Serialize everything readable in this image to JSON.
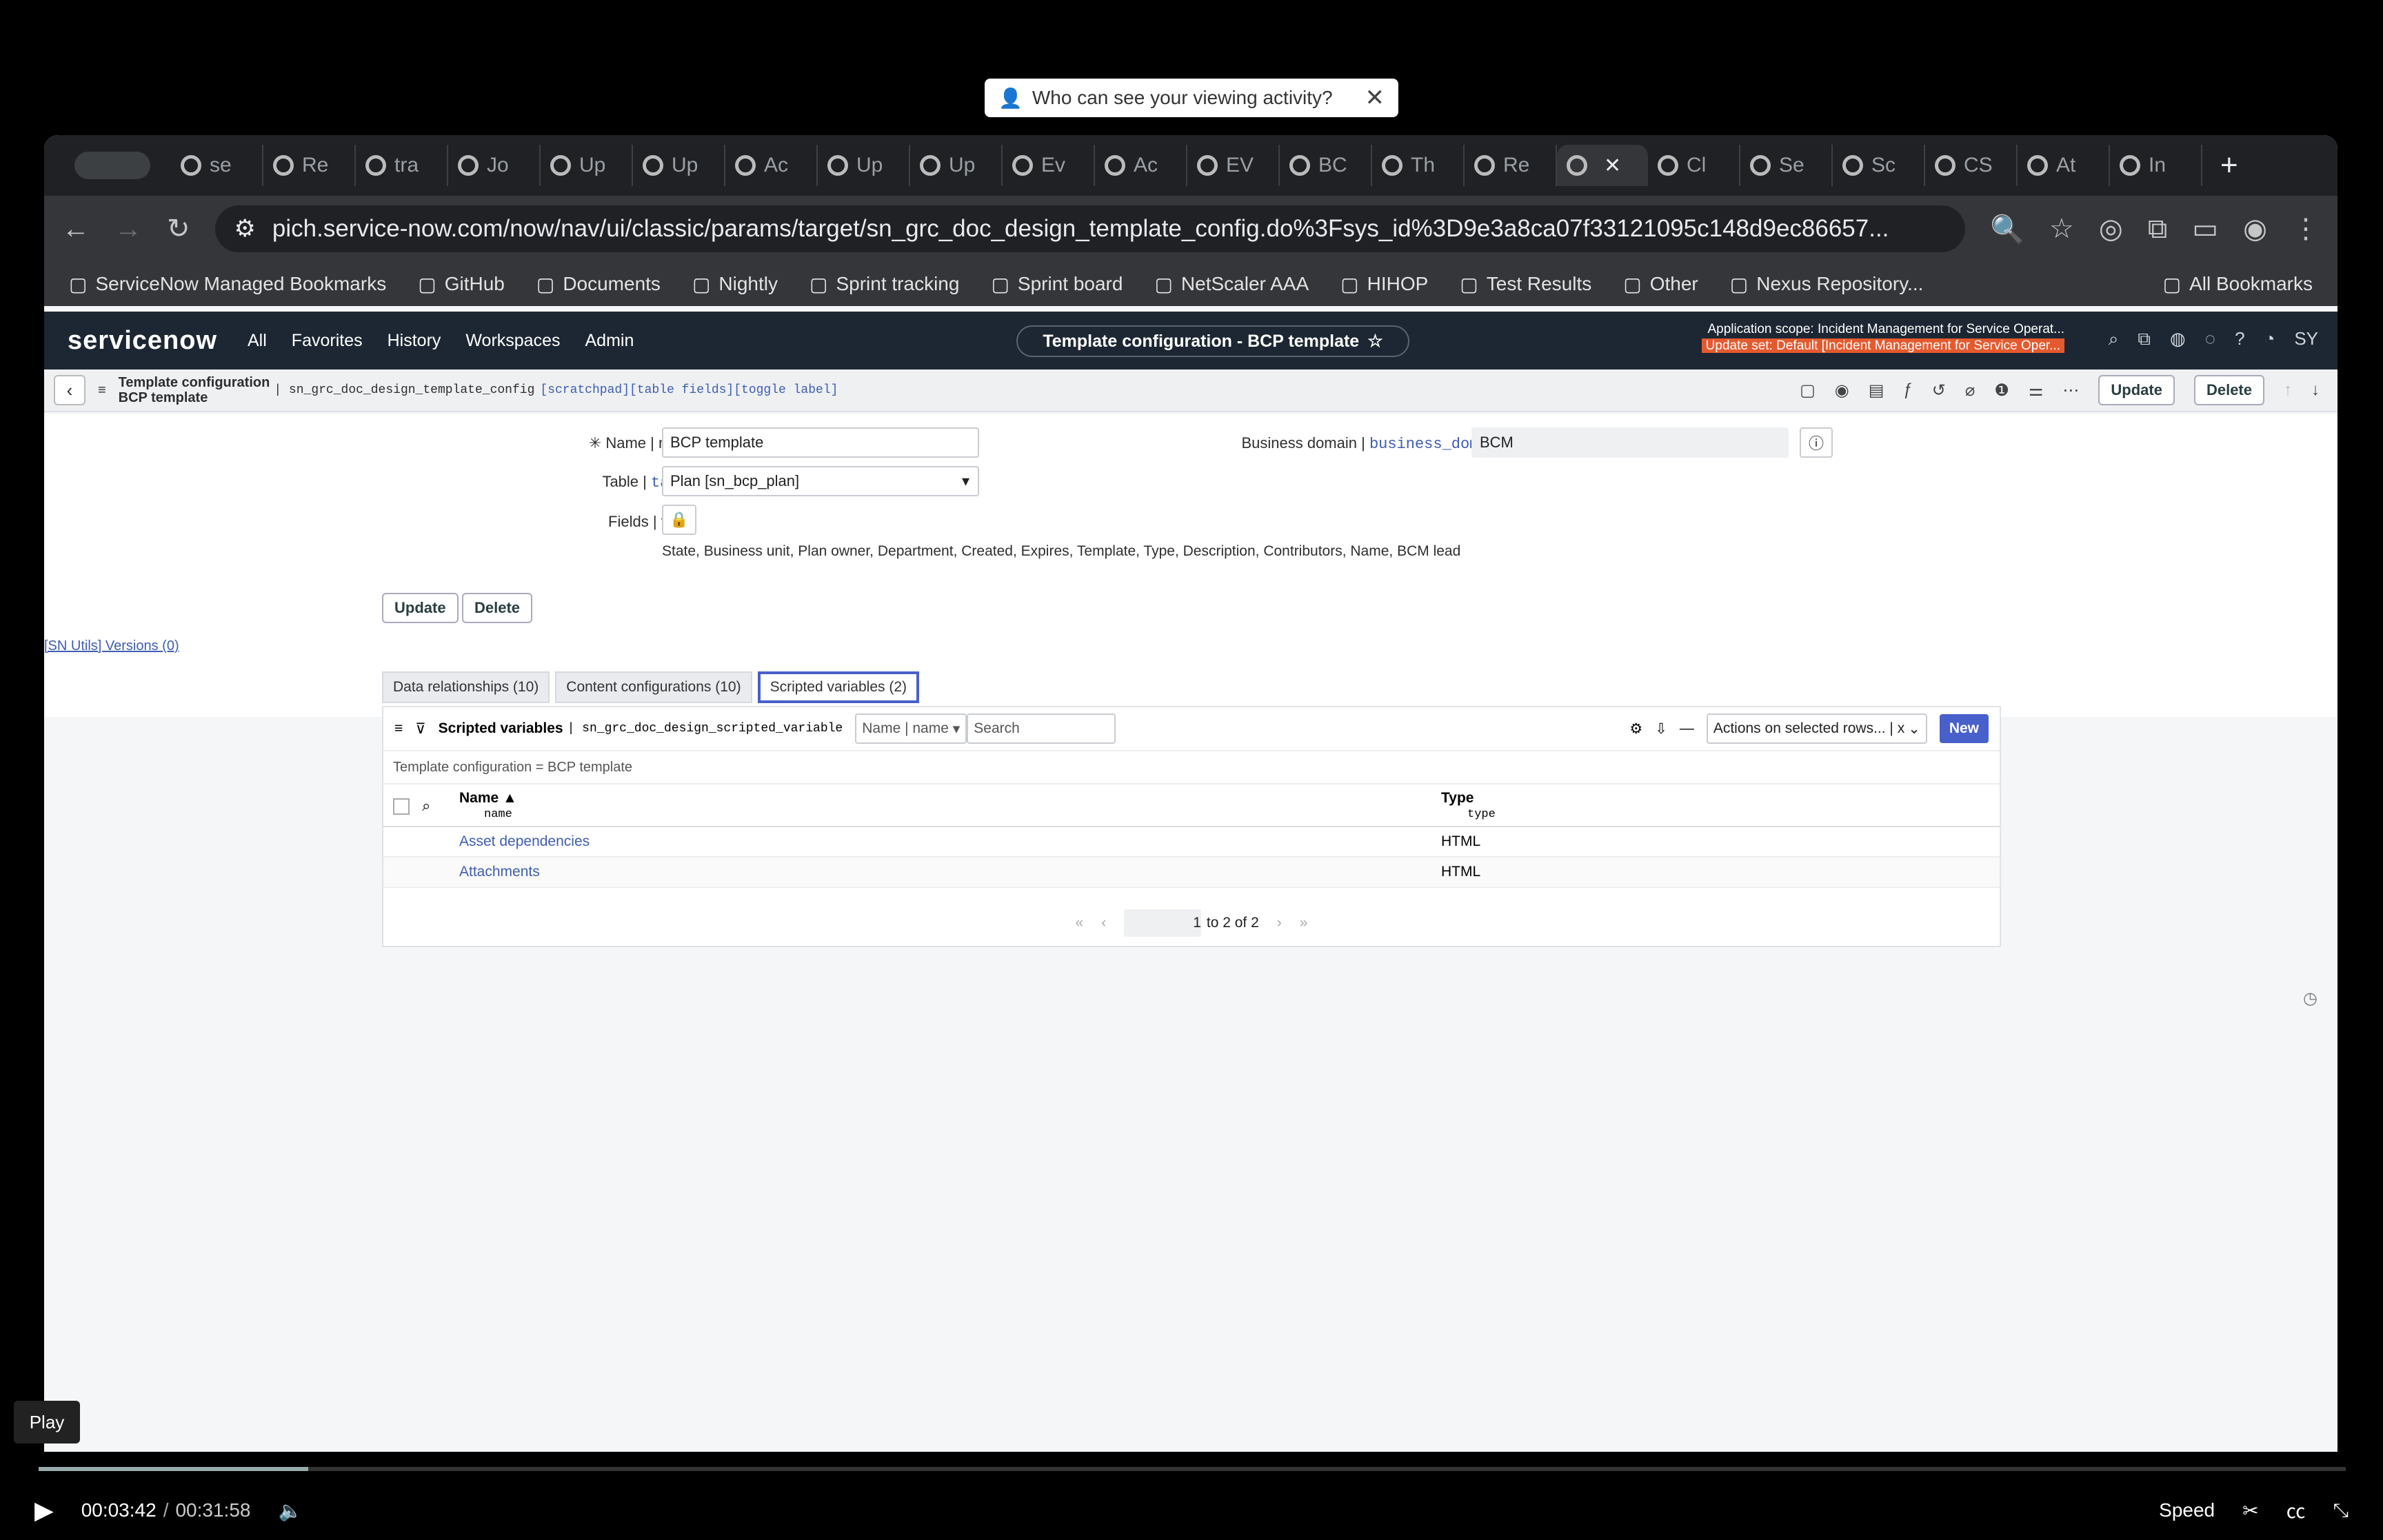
{
  "viewer_banner": {
    "text": "Who can see your viewing activity?"
  },
  "browser": {
    "tabs": [
      "se",
      "Re",
      "tra",
      "Jo",
      "Up",
      "Up",
      "Ac",
      "Up",
      "Up",
      "Ev",
      "Ac",
      "EV",
      "BC",
      "Th",
      "Re",
      "",
      "Cl",
      "Se",
      "Sc",
      "CS",
      "At",
      "In"
    ],
    "url": "pich.service-now.com/now/nav/ui/classic/params/target/sn_grc_doc_design_template_config.do%3Fsys_id%3D9e3a8ca07f33121095c148d9ec86657...",
    "bookmarks": [
      "ServiceNow Managed Bookmarks",
      "GitHub",
      "Documents",
      "Nightly",
      "Sprint tracking",
      "Sprint board",
      "NetScaler AAA",
      "HIHOP",
      "Test Results",
      "Other",
      "Nexus Repository..."
    ],
    "all_bookmarks": "All Bookmarks"
  },
  "sn_header": {
    "logo": "servicenow",
    "nav": [
      "All",
      "Favorites",
      "History",
      "Workspaces",
      "Admin"
    ],
    "context_title": "Template configuration - BCP template",
    "scope_line1": "Application scope: Incident Management for Service Operat...",
    "scope_line2": "Update set: Default [Incident Management for Service Oper..."
  },
  "form_bar": {
    "title_line1": "Template configuration",
    "title_line2": "BCP template",
    "table_name": "| sn_grc_doc_design_template_config",
    "links": "[scratchpad][table fields][toggle label]",
    "update": "Update",
    "delete": "Delete"
  },
  "form": {
    "name_label": "Name | name",
    "name_value": "BCP template",
    "table_label_a": "Table |",
    "table_label_b": "table",
    "table_value": "Plan [sn_bcp_plan]",
    "fields_label": "Fields | fields",
    "fields_value": "State, Business unit, Plan owner, Department, Created, Expires, Template, Type, Description, Contributors, Name, BCM lead",
    "domain_label_a": "Business domain |",
    "domain_label_b": "business_domain",
    "domain_value": "BCM",
    "update": "Update",
    "delete": "Delete",
    "sn_utils": "[SN Utils] Versions (0)"
  },
  "related": {
    "tabs": [
      "Data relationships (10)",
      "Content configurations (10)",
      "Scripted variables (2)"
    ],
    "list_title": "Scripted variables",
    "list_table": "| sn_grc_doc_design_scripted_variable",
    "search_field": "Name | name",
    "search_placeholder": "Search",
    "actions": "Actions on selected rows... | x",
    "new": "New",
    "breadcrumb": "Template configuration = BCP template",
    "col_name": "Name ▲",
    "col_name_sub": "name",
    "col_type": "Type",
    "col_type_sub": "type",
    "rows": [
      {
        "name": "Asset dependencies",
        "type": "HTML"
      },
      {
        "name": "Attachments",
        "type": "HTML"
      }
    ],
    "pager_page": "1",
    "pager_text": "to 2 of 2"
  },
  "video": {
    "play_tip": "Play",
    "current": "00:03:42",
    "sep": "/",
    "total": "00:31:58",
    "speed": "Speed",
    "progress": 0.117
  }
}
